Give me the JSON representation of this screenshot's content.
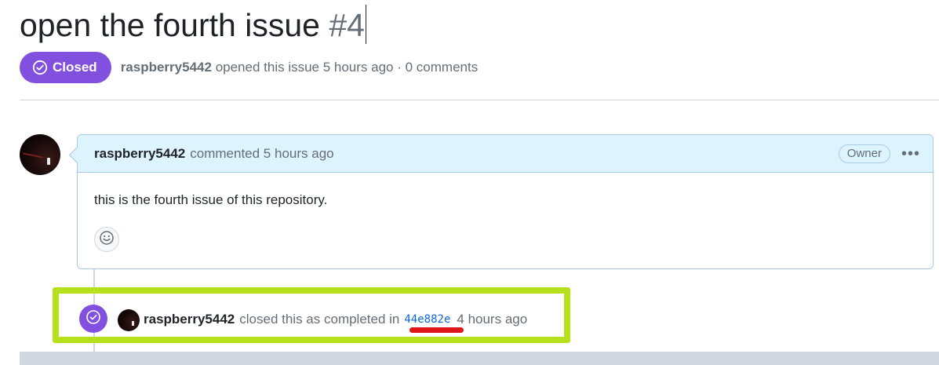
{
  "issue": {
    "title": "open the fourth issue",
    "number": "#4",
    "state_label": "Closed",
    "state_color": "#8250df",
    "author": "raspberry5442",
    "meta_text": "opened this issue 5 hours ago · 0 comments"
  },
  "comment": {
    "author": "raspberry5442",
    "action_text": "commented 5 hours ago",
    "role_badge": "Owner",
    "more_icon": "kebab-horizontal-icon",
    "body": "this is the fourth issue of this repository.",
    "reaction_icon": "smiley-icon"
  },
  "event": {
    "icon": "check-circle-icon",
    "author": "raspberry5442",
    "action_text": "closed this as completed in",
    "commit": "44e882e",
    "time": "4 hours ago",
    "highlight_color": "#b5e01b",
    "underline_color": "#e0161b"
  }
}
